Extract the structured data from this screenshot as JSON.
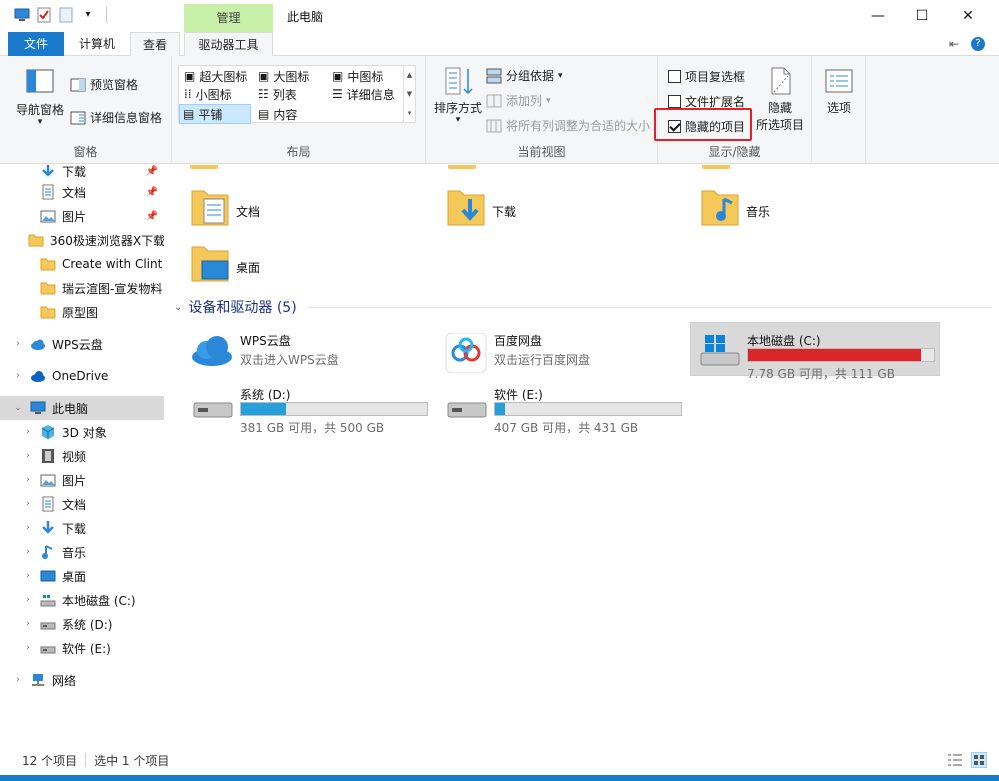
{
  "window": {
    "title": "此电脑",
    "context_tab_header": "管理",
    "minimize_glyph": "—",
    "maximize_glyph": "☐",
    "close_glyph": "✕"
  },
  "tabs": {
    "file": "文件",
    "computer": "计算机",
    "view": "查看",
    "drive_tools": "驱动器工具",
    "pin_glyph": "⇤",
    "help_glyph": "?"
  },
  "ribbon": {
    "panes": {
      "label": "窗格",
      "nav_pane": "导航窗格",
      "preview_pane": "预览窗格",
      "details_pane": "详细信息窗格"
    },
    "layout": {
      "label": "布局",
      "items": [
        "超大图标",
        "大图标",
        "中图标",
        "小图标",
        "列表",
        "详细信息",
        "平铺",
        "内容"
      ]
    },
    "current_view": {
      "label": "当前视图",
      "sort_by": "排序方式",
      "group_by": "分组依据",
      "add_column": "添加列",
      "fit_columns": "将所有列调整为合适的大小"
    },
    "show_hide": {
      "label": "显示/隐藏",
      "item_checkboxes": "项目复选框",
      "item_checkboxes_checked": false,
      "file_extensions": "文件扩展名",
      "file_extensions_checked": false,
      "hidden_items": "隐藏的项目",
      "hidden_items_checked": true,
      "hide_selected_line1": "隐藏",
      "hide_selected_line2": "所选项目"
    },
    "options": "选项"
  },
  "nav": {
    "items": [
      {
        "label": "下载",
        "icon": "download-icon",
        "pinned": true
      },
      {
        "label": "文档",
        "icon": "document-icon",
        "pinned": true
      },
      {
        "label": "图片",
        "icon": "picture-icon",
        "pinned": true
      },
      {
        "label": "360极速浏览器X下载",
        "icon": "folder-icon",
        "pinned": false
      },
      {
        "label": "Create with Clint",
        "icon": "folder-icon",
        "pinned": false
      },
      {
        "label": "瑞云渲图-宣发物料",
        "icon": "folder-icon",
        "pinned": false
      },
      {
        "label": "原型图",
        "icon": "folder-icon",
        "pinned": false
      },
      {
        "label": "WPS云盘",
        "icon": "cloud-icon",
        "pinned": false
      },
      {
        "label": "OneDrive",
        "icon": "onedrive-icon",
        "pinned": false
      },
      {
        "label": "此电脑",
        "icon": "computer-icon",
        "pinned": false
      },
      {
        "label": "3D 对象",
        "icon": "3d-objects-icon",
        "pinned": false
      },
      {
        "label": "视频",
        "icon": "video-icon",
        "pinned": false
      },
      {
        "label": "图片",
        "icon": "picture-icon",
        "pinned": false
      },
      {
        "label": "文档",
        "icon": "document-icon",
        "pinned": false
      },
      {
        "label": "下载",
        "icon": "download-icon",
        "pinned": false
      },
      {
        "label": "音乐",
        "icon": "music-icon",
        "pinned": false
      },
      {
        "label": "桌面",
        "icon": "desktop-icon",
        "pinned": false
      },
      {
        "label": "本地磁盘 (C:)",
        "icon": "drive-c-icon",
        "pinned": false
      },
      {
        "label": "系统 (D:)",
        "icon": "drive-icon",
        "pinned": false
      },
      {
        "label": "软件 (E:)",
        "icon": "drive-icon",
        "pinned": false
      },
      {
        "label": "网络",
        "icon": "network-icon",
        "pinned": false
      }
    ]
  },
  "content": {
    "folders": [
      {
        "label": "文档",
        "icon": "documents-folder-icon"
      },
      {
        "label": "下载",
        "icon": "downloads-folder-icon"
      },
      {
        "label": "音乐",
        "icon": "music-folder-icon"
      },
      {
        "label": "桌面",
        "icon": "desktop-folder-icon"
      }
    ],
    "devices_header": "设备和驱动器 (5)",
    "devices": [
      {
        "name": "WPS云盘",
        "subtitle": "双击进入WPS云盘",
        "icon": "wps-cloud-icon"
      },
      {
        "name": "百度网盘",
        "subtitle": "双击运行百度网盘",
        "icon": "baidu-netdisk-icon"
      },
      {
        "name": "本地磁盘 (C:)",
        "info": "7.78 GB 可用，共 111 GB",
        "used_fraction": 0.93,
        "icon": "windows-drive-icon",
        "selected": true
      },
      {
        "name": "系统 (D:)",
        "info": "381 GB 可用，共 500 GB",
        "used_fraction": 0.24,
        "icon": "drive-icon"
      },
      {
        "name": "软件 (E:)",
        "info": "407 GB 可用，共 431 GB",
        "used_fraction": 0.056,
        "icon": "drive-icon"
      }
    ]
  },
  "status": {
    "item_count": "12 个项目",
    "selected": "选中 1 个项目"
  },
  "colors": {
    "accent": "#1979ca",
    "context_tab": "#c9f0a8",
    "drive_bar": "#26a0da",
    "drive_bar_full": "#da2626",
    "highlight_box": "#e5202a"
  }
}
